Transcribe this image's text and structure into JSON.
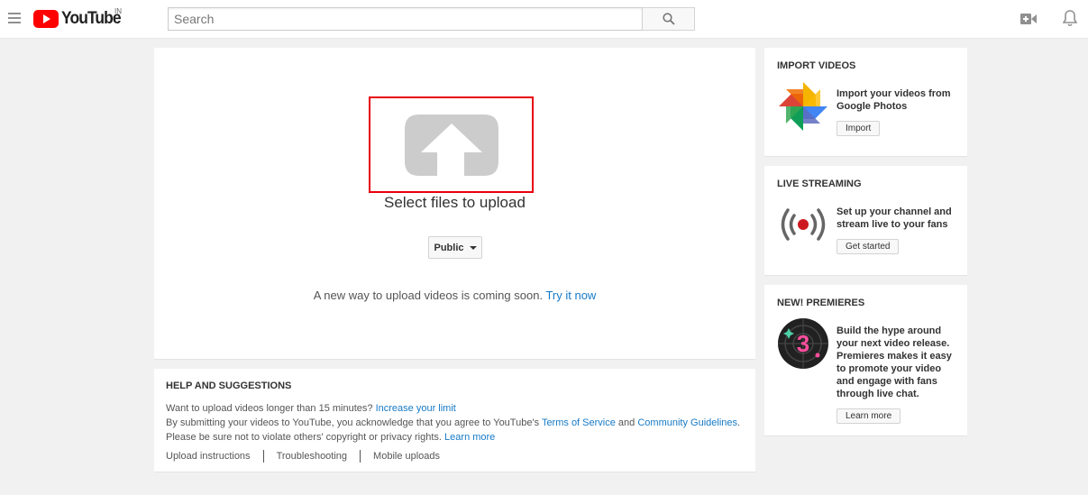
{
  "header": {
    "logo_text": "YouTube",
    "region": "IN",
    "search_placeholder": "Search"
  },
  "upload": {
    "select_label": "Select files to upload",
    "privacy_value": "Public",
    "notice_text": "A new way to upload videos is coming soon.",
    "notice_link": "Try it now"
  },
  "help": {
    "title": "HELP AND SUGGESTIONS",
    "line1_text": "Want to upload videos longer than 15 minutes?",
    "line1_link": "Increase your limit",
    "line2_text": "By submitting your videos to YouTube, you acknowledge that you agree to YouTube's",
    "line2_link1": "Terms of Service",
    "line2_and": "and",
    "line2_link2": "Community Guidelines",
    "line2_end": ".",
    "line3_text": "Please be sure not to violate others' copyright or privacy rights.",
    "line3_link": "Learn more",
    "links": [
      "Upload instructions",
      "Troubleshooting",
      "Mobile uploads"
    ]
  },
  "import_card": {
    "title": "IMPORT VIDEOS",
    "text": "Import your videos from Google Photos",
    "button": "Import"
  },
  "live_card": {
    "title": "LIVE STREAMING",
    "text": "Set up your channel and stream live to your fans",
    "button": "Get started"
  },
  "premieres_card": {
    "title": "NEW! PREMIERES",
    "text": "Build the hype around your next video release. Premieres makes it easy to promote your video and engage with fans through live chat.",
    "button": "Learn more",
    "icon_digit": "3"
  },
  "colors": {
    "brand_red": "#ff0000",
    "link_blue": "#167ac6",
    "highlight_red": "#e8000b"
  }
}
